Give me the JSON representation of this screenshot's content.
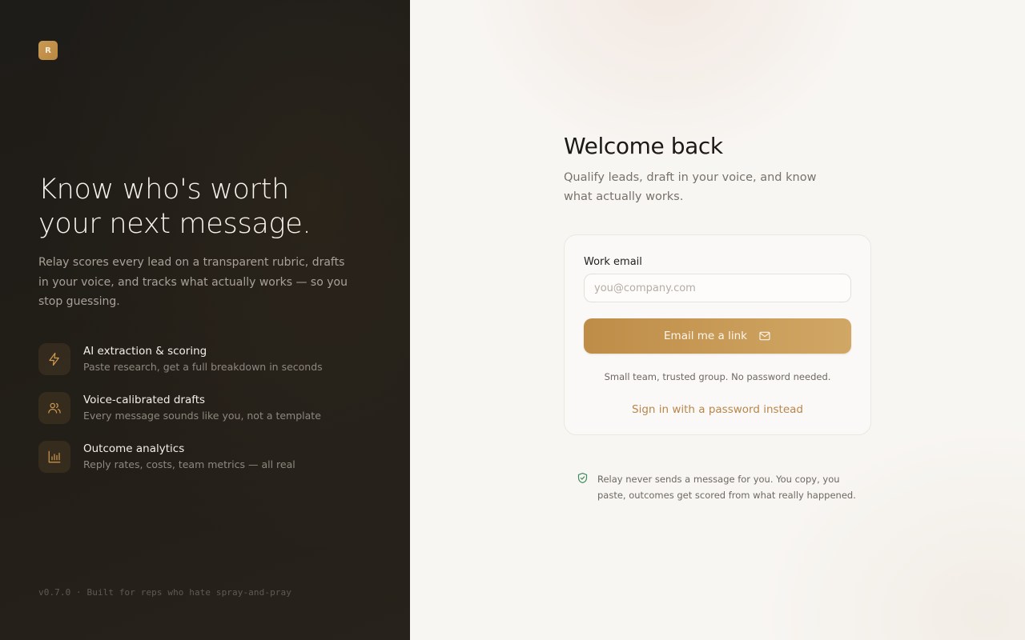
{
  "brand": {
    "logo_letter": "R",
    "accent": "#c99a55",
    "dark_bg": "#1e1c19"
  },
  "hero": {
    "title_line1": "Know who's worth",
    "title_line2": "your next message.",
    "subtitle": "Relay scores every lead on a transparent rubric, drafts in your voice, and tracks what actually works — so you stop guessing."
  },
  "features": [
    {
      "icon": "lightning-icon",
      "title": "AI extraction & scoring",
      "description": "Paste research, get a full breakdown in seconds"
    },
    {
      "icon": "users-icon",
      "title": "Voice-calibrated drafts",
      "description": "Every message sounds like you, not a template"
    },
    {
      "icon": "bar-chart-icon",
      "title": "Outcome analytics",
      "description": "Reply rates, costs, team metrics — all real"
    }
  ],
  "footer": {
    "version_text": "v0.7.0 · Built for reps who hate spray-and-pray"
  },
  "auth": {
    "title": "Welcome back",
    "subtitle": "Qualify leads, draft in your voice, and know what actually works.",
    "email_label": "Work email",
    "email_value": "",
    "email_placeholder": "you@company.com",
    "submit_label": "Email me a link",
    "submit_icon": "mail-icon",
    "hint": "Small team, trusted group. No password needed.",
    "password_link": "Sign in with a password instead",
    "notice_icon": "shield-check-icon",
    "notice": "Relay never sends a message for you. You copy, you paste, outcomes get scored from what really happened.",
    "notice_color": "#3f8a5c"
  }
}
